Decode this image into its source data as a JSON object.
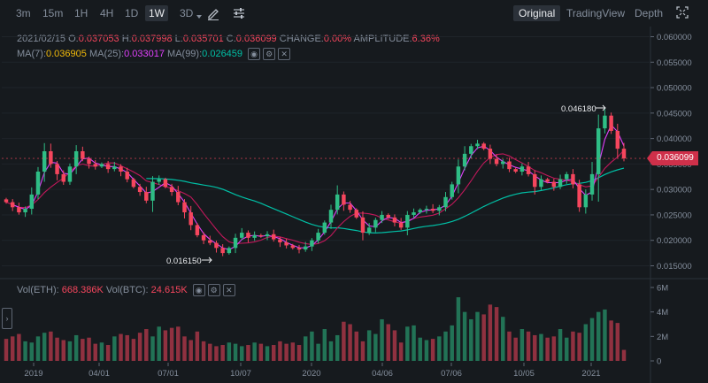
{
  "toolbar": {
    "intervals": [
      "3m",
      "15m",
      "1H",
      "4H",
      "1D",
      "1W",
      "3D"
    ],
    "active_interval": "1W",
    "views": [
      "Original",
      "TradingView",
      "Depth"
    ],
    "active_view": "Original",
    "icons": [
      "chevron-down-icon",
      "pencil-icon",
      "settings-sliders-icon",
      "fullscreen-icon"
    ]
  },
  "ohlc": {
    "date": "2021/02/15",
    "o_label": "O:",
    "o": "0.037053",
    "h_label": "H:",
    "h": "0.037998",
    "l_label": "L:",
    "l": "0.035701",
    "c_label": "C:",
    "c": "0.036099",
    "change_label": "CHANGE:",
    "change": "0.00%",
    "amplitude_label": "AMPLITUDE:",
    "amplitude": "6.36%"
  },
  "ma": {
    "ma7_label": "MA(7):",
    "ma7": "0.036905",
    "ma25_label": "MA(25):",
    "ma25": "0.033017",
    "ma99_label": "MA(99):",
    "ma99": "0.026459"
  },
  "volume": {
    "eth_label": "Vol(ETH):",
    "eth": "668.386K",
    "btc_label": "Vol(BTC):",
    "btc": "24.615K"
  },
  "colors": {
    "up": "#2ebd85",
    "down": "#f6465d",
    "ma7": "#f0b90b",
    "ma25": "#e040fb",
    "ma99": "#00bfa5",
    "background": "#161a1e"
  },
  "chart_data": {
    "type": "candlestick",
    "y_ticks": [
      "0.060000",
      "0.055000",
      "0.050000",
      "0.045000",
      "0.040000",
      "0.035000",
      "0.030000",
      "0.025000",
      "0.020000",
      "0.015000"
    ],
    "ylim": [
      0.013,
      0.062
    ],
    "vol_ticks": [
      "6M",
      "4M",
      "2M",
      "0"
    ],
    "vol_ylim": [
      0,
      6
    ],
    "x_labels": [
      "2019",
      "04/01",
      "07/01",
      "10/07",
      "2020",
      "04/06",
      "07/06",
      "10/05",
      "2021"
    ],
    "last_price": "0.036099",
    "annotations": {
      "high": "0.046180",
      "low": "0.016150"
    },
    "close": [
      0.0275,
      0.0265,
      0.0255,
      0.0262,
      0.029,
      0.0335,
      0.0375,
      0.035,
      0.033,
      0.0315,
      0.0345,
      0.0375,
      0.036,
      0.035,
      0.0345,
      0.035,
      0.034,
      0.0345,
      0.0335,
      0.032,
      0.0305,
      0.0295,
      0.0278,
      0.0315,
      0.032,
      0.0305,
      0.0295,
      0.0275,
      0.0255,
      0.023,
      0.021,
      0.02,
      0.0195,
      0.0185,
      0.0175,
      0.0185,
      0.0205,
      0.0215,
      0.0205,
      0.021,
      0.0208,
      0.0212,
      0.0202,
      0.0196,
      0.019,
      0.0185,
      0.0182,
      0.0188,
      0.02,
      0.0215,
      0.0235,
      0.026,
      0.029,
      0.027,
      0.026,
      0.0245,
      0.0215,
      0.0225,
      0.024,
      0.025,
      0.0245,
      0.0235,
      0.0225,
      0.025,
      0.0255,
      0.026,
      0.0262,
      0.0258,
      0.0265,
      0.0285,
      0.031,
      0.0345,
      0.037,
      0.0385,
      0.039,
      0.038,
      0.036,
      0.035,
      0.0355,
      0.034,
      0.0335,
      0.0345,
      0.033,
      0.0305,
      0.032,
      0.0315,
      0.0305,
      0.032,
      0.033,
      0.031,
      0.0265,
      0.029,
      0.033,
      0.042,
      0.0445,
      0.0415,
      0.038,
      0.0361
    ],
    "volume": [
      1.8,
      2.0,
      2.2,
      1.6,
      1.5,
      2.0,
      2.3,
      2.4,
      1.9,
      1.7,
      1.6,
      2.1,
      1.8,
      1.9,
      1.4,
      1.5,
      1.3,
      2.0,
      2.2,
      2.1,
      1.8,
      2.3,
      2.6,
      2.0,
      2.8,
      2.5,
      2.7,
      2.8,
      2.0,
      1.7,
      2.4,
      1.6,
      1.4,
      1.2,
      1.3,
      1.5,
      1.4,
      1.2,
      1.3,
      1.5,
      1.4,
      1.2,
      1.3,
      1.6,
      1.4,
      1.5,
      1.3,
      2.0,
      2.4,
      1.4,
      2.6,
      1.6,
      2.1,
      3.2,
      3.0,
      2.4,
      1.6,
      2.5,
      2.2,
      3.4,
      3.0,
      2.5,
      1.5,
      2.8,
      2.9,
      1.9,
      1.7,
      1.8,
      2.0,
      2.4,
      2.9,
      5.2,
      4.0,
      3.4,
      4.0,
      3.8,
      4.6,
      4.4,
      3.6,
      2.4,
      1.9,
      2.6,
      2.4,
      2.1,
      2.2,
      1.9,
      2.0,
      2.6,
      1.9,
      2.4,
      2.3,
      3.0,
      3.5,
      4.0,
      4.2,
      3.3,
      3.1,
      0.9
    ]
  }
}
